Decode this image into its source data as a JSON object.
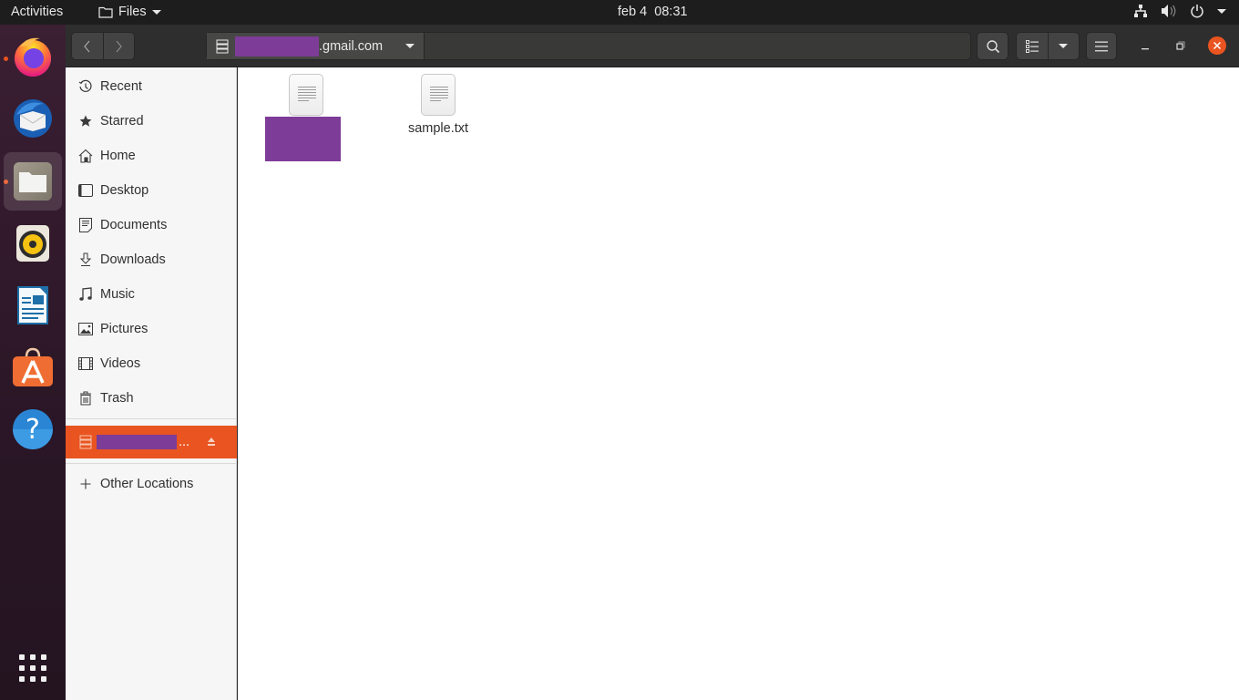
{
  "topbar": {
    "activities": "Activities",
    "app_name": "Files",
    "clock": "feb 4  08:31",
    "tray_icons": [
      "network-icon",
      "volume-icon",
      "power-icon",
      "system-menu-caret"
    ]
  },
  "dock": {
    "apps": [
      {
        "name": "Firefox",
        "icon": "firefox-icon",
        "running": true,
        "active": false
      },
      {
        "name": "Thunderbird",
        "icon": "thunderbird-icon",
        "running": false,
        "active": false
      },
      {
        "name": "Files",
        "icon": "files-icon",
        "running": true,
        "active": true
      },
      {
        "name": "Rhythmbox",
        "icon": "rhythmbox-icon",
        "running": false,
        "active": false
      },
      {
        "name": "LibreOffice Writer",
        "icon": "writer-icon",
        "running": false,
        "active": false
      },
      {
        "name": "Ubuntu Software",
        "icon": "software-icon",
        "running": false,
        "active": false
      },
      {
        "name": "Help",
        "icon": "help-icon",
        "running": false,
        "active": false
      }
    ],
    "show_apps": "show-applications-icon"
  },
  "headerbar": {
    "path_suffix": ".gmail.com",
    "path_redacted": true
  },
  "sidebar": {
    "places": [
      {
        "label": "Recent",
        "icon": "recent-icon"
      },
      {
        "label": "Starred",
        "icon": "star-icon"
      },
      {
        "label": "Home",
        "icon": "home-icon"
      },
      {
        "label": "Desktop",
        "icon": "desktop-icon"
      },
      {
        "label": "Documents",
        "icon": "documents-icon"
      },
      {
        "label": "Downloads",
        "icon": "downloads-icon"
      },
      {
        "label": "Music",
        "icon": "music-icon"
      },
      {
        "label": "Pictures",
        "icon": "pictures-icon"
      },
      {
        "label": "Videos",
        "icon": "videos-icon"
      },
      {
        "label": "Trash",
        "icon": "trash-icon"
      }
    ],
    "mounted": {
      "label_suffix": "...",
      "redacted": true,
      "selected": true
    },
    "other_locations": "Other Locations"
  },
  "files": [
    {
      "name": "",
      "redacted": true,
      "type": "text"
    },
    {
      "name": "sample.txt",
      "redacted": false,
      "type": "text"
    }
  ],
  "colors": {
    "accent": "#e95420",
    "redaction": "#7d3c98"
  }
}
